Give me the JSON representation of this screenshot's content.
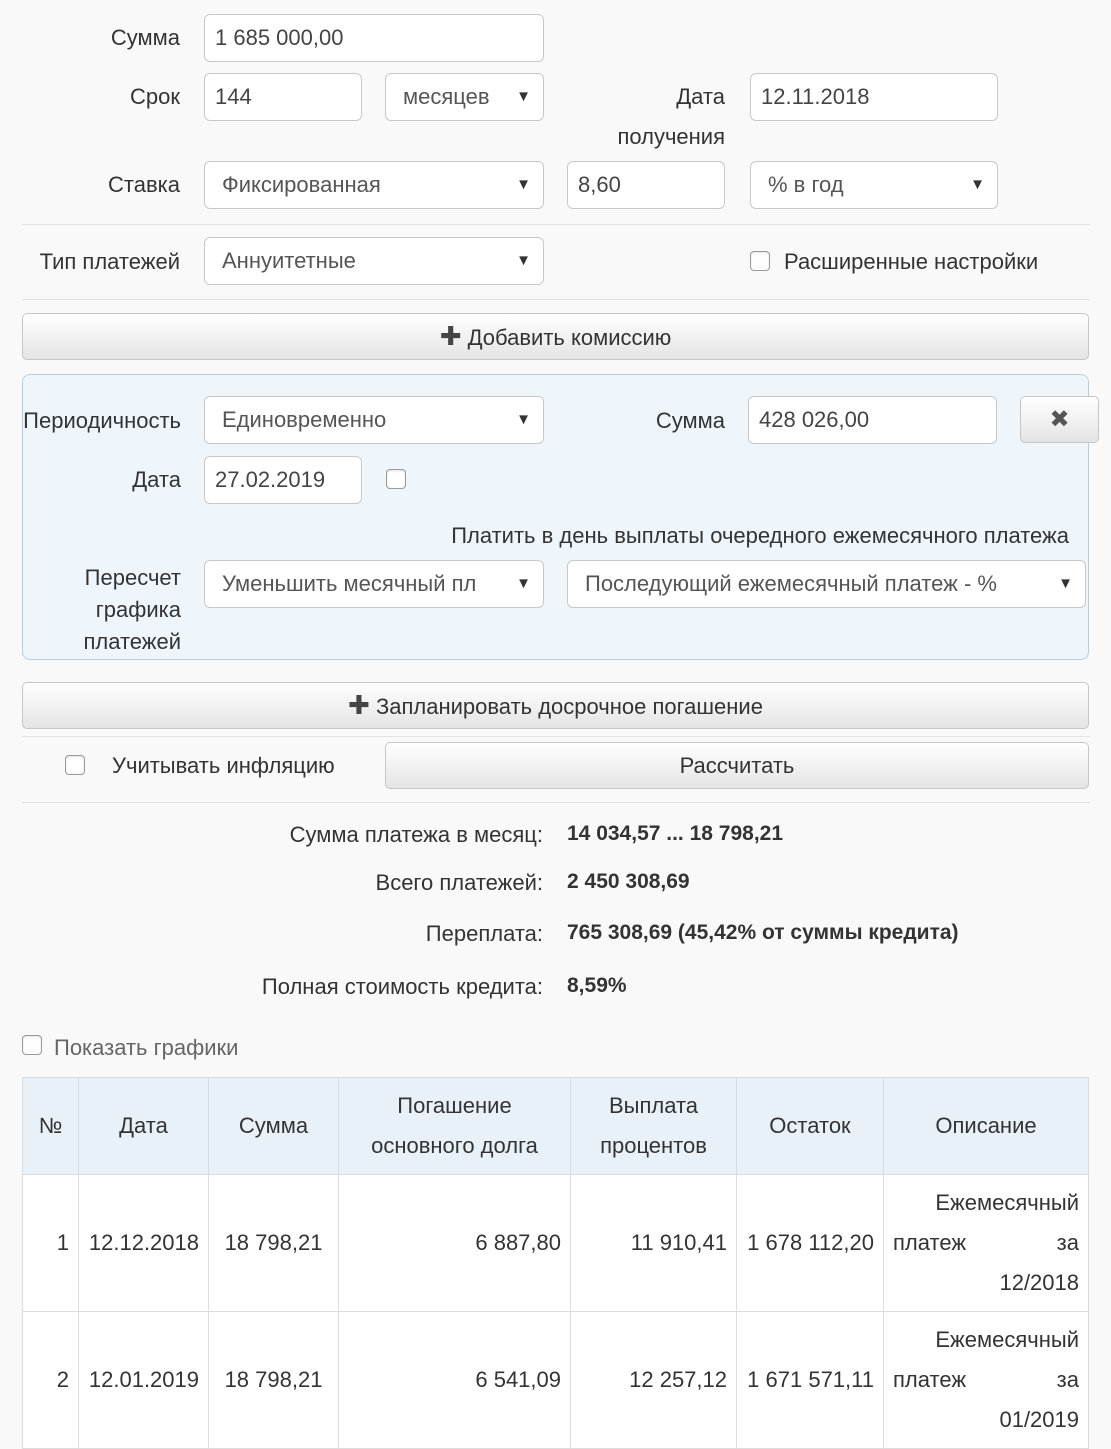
{
  "form": {
    "amount_label": "Сумма",
    "amount_value": "1 685 000,00",
    "term_label": "Срок",
    "term_value": "144",
    "term_unit": "месяцев",
    "date_label_1": "Дата",
    "date_label_2": "получения",
    "date_value": "12.11.2018",
    "rate_label": "Ставка",
    "rate_type": "Фиксированная",
    "rate_value": "8,60",
    "rate_unit": "% в год",
    "payment_type_label": "Тип платежей",
    "payment_type_value": "Аннуитетные",
    "advanced_label": "Расширенные настройки"
  },
  "commission": {
    "add_button": "Добавить комиссию",
    "periodicity_label": "Периодичность",
    "periodicity_value": "Единовременно",
    "sum_label": "Сумма",
    "sum_value": "428 026,00",
    "date_label": "Дата",
    "date_value": "27.02.2019",
    "pay_on_day_label": "Платить в день выплаты очередного ежемесячного платежа",
    "recalc_label_1": "Пересчет",
    "recalc_label_2": "графика",
    "recalc_label_3": "платежей",
    "recalc_value": "Уменьшить месячный пл",
    "next_payment_value": "Последующий ежемесячный платеж - %"
  },
  "actions": {
    "early_repayment_button": "Запланировать досрочное погашение",
    "inflation_label": "Учитывать инфляцию",
    "calculate_button": "Рассчитать"
  },
  "results": {
    "monthly_label": "Сумма платежа в месяц:",
    "monthly_value": "14 034,57 ... 18 798,21",
    "total_label": "Всего платежей:",
    "total_value": "2 450 308,69",
    "overpay_label": "Переплата:",
    "overpay_value": "765 308,69 (45,42% от суммы кредита)",
    "full_cost_label": "Полная стоимость кредита:",
    "full_cost_value": "8,59%"
  },
  "show_charts_label": "Показать графики",
  "table": {
    "headers": {
      "num": "№",
      "date": "Дата",
      "sum": "Сумма",
      "principal_1": "Погашение",
      "principal_2": "основного долга",
      "interest_1": "Выплата",
      "interest_2": "процентов",
      "balance": "Остаток",
      "desc": "Описание"
    },
    "rows": [
      {
        "num": "1",
        "date": "12.12.2018",
        "sum": "18 798,21",
        "principal": "6 887,80",
        "interest": "11 910,41",
        "balance": "1 678 112,20",
        "desc_1": "Ежемесячный",
        "desc_2a": "платеж",
        "desc_2b": "за",
        "desc_3": "12/2018"
      },
      {
        "num": "2",
        "date": "12.01.2019",
        "sum": "18 798,21",
        "principal": "6 541,09",
        "interest": "12 257,12",
        "balance": "1 671 571,11",
        "desc_1": "Ежемесячный",
        "desc_2a": "платеж",
        "desc_2b": "за",
        "desc_3": "01/2019"
      }
    ]
  }
}
